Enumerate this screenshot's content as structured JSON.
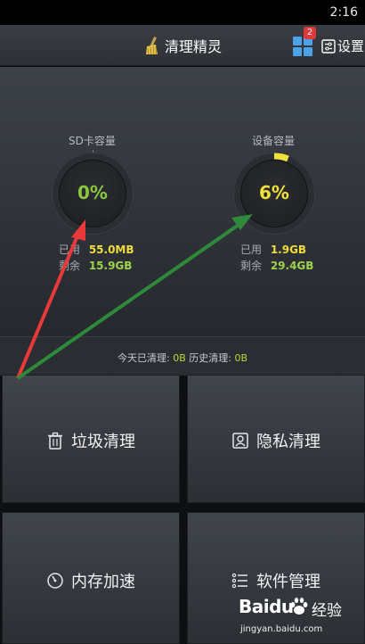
{
  "status": {
    "time": "2:16"
  },
  "header": {
    "title": "清理精灵",
    "badge_count": "2",
    "settings_label": "设置"
  },
  "sd_card": {
    "label": "SD卡容量",
    "percent_text": "0%",
    "used_fraction": 0.0,
    "used_key": "已用",
    "used_value": "55.0MB",
    "remaining_key": "剩余",
    "remaining_value": "15.9GB"
  },
  "device": {
    "label": "设备容量",
    "percent_text": "6%",
    "used_fraction": 0.06,
    "used_key": "已用",
    "used_value": "1.9GB",
    "remaining_key": "剩余",
    "remaining_value": "29.4GB"
  },
  "summary": {
    "today_label": "今天已清理: ",
    "today_value": "0B",
    "history_label": " 历史清理: ",
    "history_value": "0B"
  },
  "tiles": {
    "junk": "垃圾清理",
    "privacy": "隐私清理",
    "memory": "内存加速",
    "software": "软件管理"
  },
  "watermark": {
    "brand": "Baidu",
    "brand_cn": "经验",
    "url": "jingyan.baidu.com"
  },
  "colors": {
    "sd_percent": "#8ac640",
    "device_percent": "#f0e03c",
    "used_value": "#f2dc3c",
    "remaining_value": "#9ed24a",
    "annotation_red": "#e8393b",
    "annotation_green": "#2e8a3a"
  }
}
